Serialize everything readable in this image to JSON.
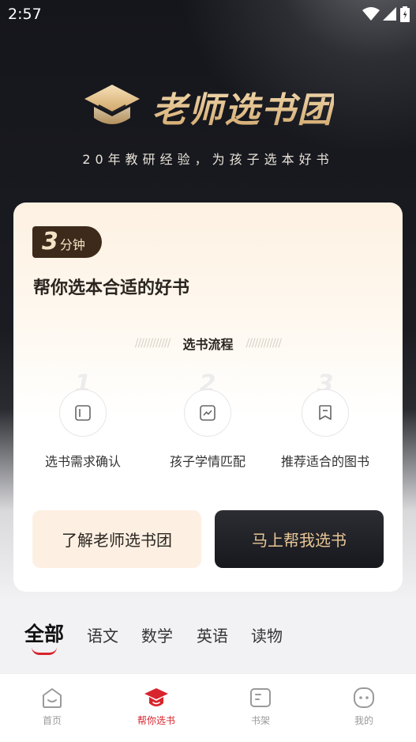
{
  "status_bar": {
    "time": "2:57"
  },
  "brand": {
    "title": "老师选书团",
    "subtitle": "20年教研经验，为孩子选本好书"
  },
  "card": {
    "badge_number": "3",
    "badge_unit": "分钟",
    "title": "帮你选本合适的好书",
    "flow_label": "选书流程",
    "hatch": "////////////",
    "steps": [
      {
        "number": "1",
        "label": "选书需求确认",
        "icon": "document-icon"
      },
      {
        "number": "2",
        "label": "孩子学情匹配",
        "icon": "trend-chart-icon"
      },
      {
        "number": "3",
        "label": "推荐适合的图书",
        "icon": "bookmark-icon"
      }
    ],
    "learn_button": "了解老师选书团",
    "select_button": "马上帮我选书"
  },
  "subject_tabs": {
    "items": [
      "全部",
      "语文",
      "数学",
      "英语",
      "读物"
    ],
    "active": "全部"
  },
  "bottom_nav": {
    "items": [
      {
        "label": "首页",
        "icon": "home-icon"
      },
      {
        "label": "帮你选书",
        "icon": "graduation-cap-icon"
      },
      {
        "label": "书架",
        "icon": "bookshelf-icon"
      },
      {
        "label": "我的",
        "icon": "profile-icon"
      }
    ],
    "active": "帮你选书"
  },
  "colors": {
    "accent": "#d8242d",
    "gold": "#e9c796",
    "badge_bg": "#3d2a1a",
    "dark_button": "#1c1d22"
  }
}
